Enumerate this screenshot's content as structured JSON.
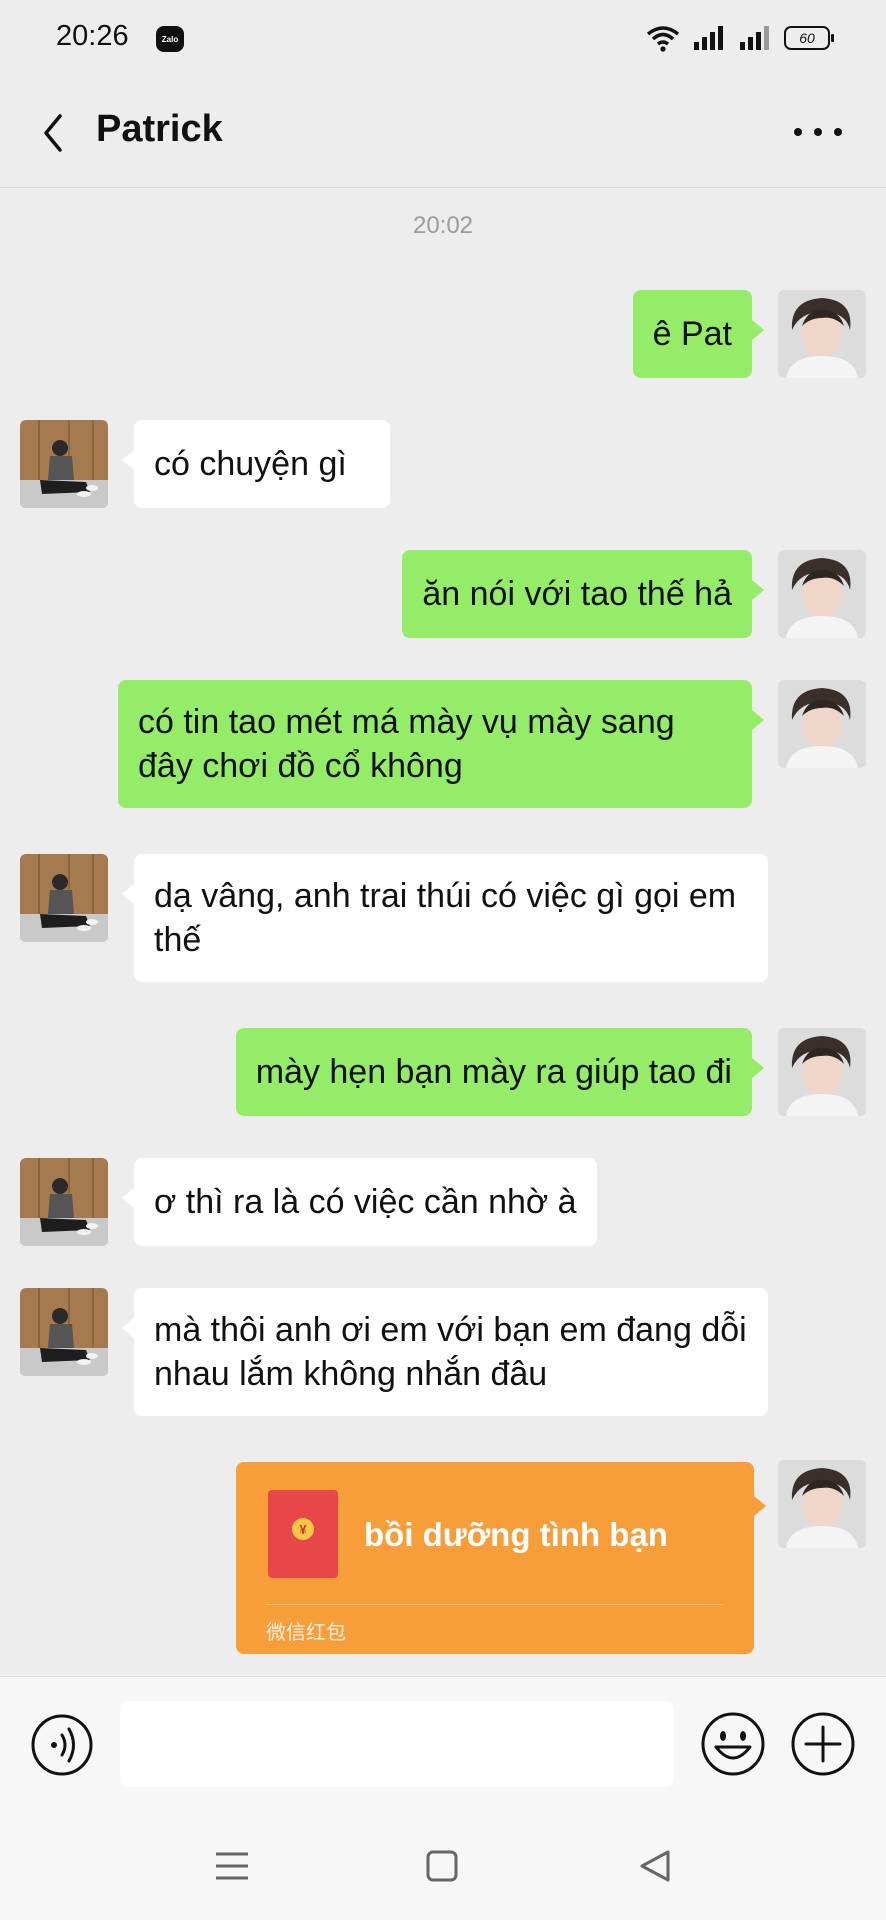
{
  "status": {
    "time": "20:26",
    "zalo_label": "Zalo",
    "battery": "60"
  },
  "header": {
    "title": "Patrick"
  },
  "chat": {
    "timestamp": "20:02",
    "messages": [
      {
        "sender": "me",
        "text": "ê Pat"
      },
      {
        "sender": "other",
        "text": "có chuyện gì"
      },
      {
        "sender": "me",
        "text": "ăn nói với tao thế hả"
      },
      {
        "sender": "me",
        "text": "có tin tao mét má mày vụ mày sang đây chơi đồ cổ không"
      },
      {
        "sender": "other",
        "text": "dạ vâng, anh trai thúi có việc gì gọi em thế"
      },
      {
        "sender": "me",
        "text": "mày hẹn bạn mày ra giúp tao đi"
      },
      {
        "sender": "other",
        "text": "ơ thì ra là có việc cần nhờ à"
      },
      {
        "sender": "other",
        "text": "mà thôi anh ơi em với bạn em đang dỗi nhau lắm không nhắn đâu"
      }
    ],
    "red_packet": {
      "title": "bồi dưỡng tình bạn",
      "subtitle": "微信红包",
      "coin": "¥"
    }
  },
  "input": {
    "placeholder": ""
  },
  "colors": {
    "my_bubble": "#95ec69",
    "their_bubble": "#ffffff",
    "red_packet": "#f79e3b",
    "background": "#ededed"
  }
}
